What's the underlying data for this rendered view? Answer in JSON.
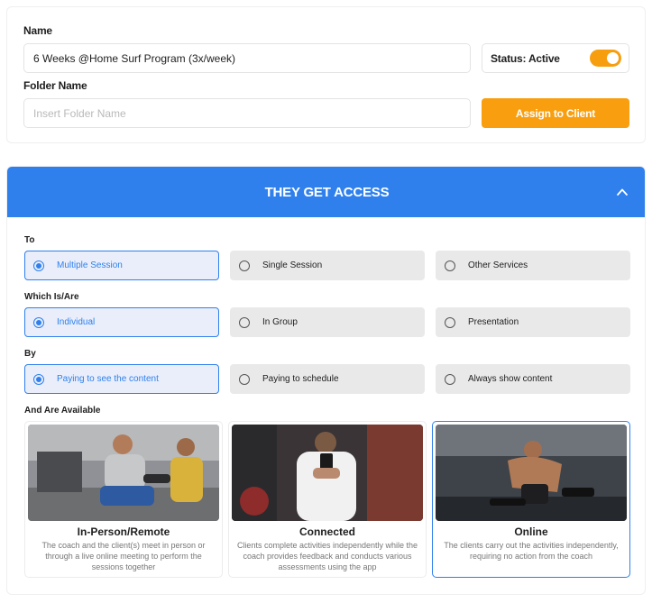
{
  "program": {
    "name_label": "Name",
    "name_value": "6 Weeks @Home Surf Program (3x/week)",
    "status_label": "Status: Active",
    "folder_label": "Folder Name",
    "folder_placeholder": "Insert Folder Name",
    "assign_label": "Assign to Client"
  },
  "access": {
    "title": "THEY GET ACCESS",
    "to": {
      "label": "To",
      "options": [
        "Multiple Session",
        "Single Session",
        "Other Services"
      ],
      "selected": "Multiple Session"
    },
    "which": {
      "label": "Which Is/Are",
      "options": [
        "Individual",
        "In Group",
        "Presentation"
      ],
      "selected": "Individual"
    },
    "by": {
      "label": "By",
      "options": [
        "Paying to see the content",
        "Paying to schedule",
        "Always show content"
      ],
      "selected": "Paying to see the content"
    },
    "available": {
      "label": "And Are Available",
      "options": [
        {
          "title": "In-Person/Remote",
          "desc": "The coach and the client(s) meet in person or through a live online meeting to perform the sessions together"
        },
        {
          "title": "Connected",
          "desc": "Clients complete activities independently while the coach provides feedback and conducts various assessments using the app"
        },
        {
          "title": "Online",
          "desc": "The clients carry out the activities independently, requiring no action from the coach"
        }
      ],
      "selected": "Online"
    }
  },
  "colors": {
    "accent": "#2f80ed",
    "orange": "#f99f0f"
  }
}
